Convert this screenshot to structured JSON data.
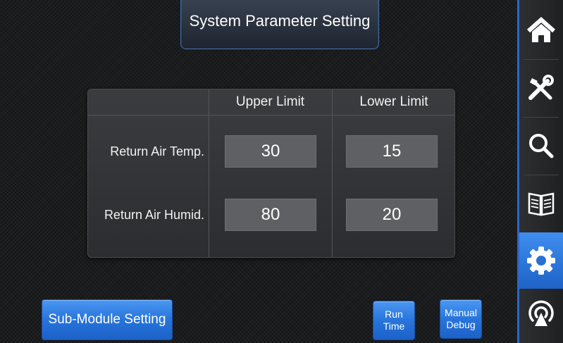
{
  "title": "System Parameter Setting",
  "table": {
    "headers": [
      "Upper Limit",
      "Lower Limit"
    ],
    "rows": [
      {
        "label": "Return Air Temp.",
        "upper": "30",
        "lower": "15"
      },
      {
        "label": "Return Air Humid.",
        "upper": "80",
        "lower": "20"
      }
    ]
  },
  "buttons": {
    "sub_module": "Sub-Module Setting",
    "run_time_line1": "Run",
    "run_time_line2": "Time",
    "manual_debug_line1": "Manual",
    "manual_debug_line2": "Debug"
  },
  "sidebar": {
    "items": [
      {
        "icon": "home-icon",
        "active": false
      },
      {
        "icon": "tools-icon",
        "active": false
      },
      {
        "icon": "search-icon",
        "active": false
      },
      {
        "icon": "book-icon",
        "active": false
      },
      {
        "icon": "gear-icon",
        "active": true
      },
      {
        "icon": "signal-icon",
        "active": false
      }
    ]
  },
  "colors": {
    "accent": "#2a6fd6",
    "background": "#1b1c1e",
    "value_box": "#5f6063"
  }
}
